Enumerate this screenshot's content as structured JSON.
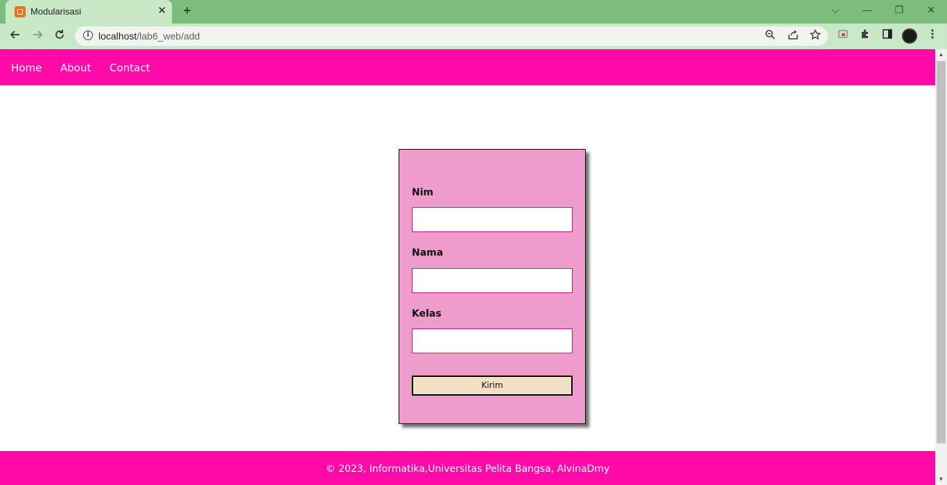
{
  "browser": {
    "tab_title": "Modularisasi",
    "tab_close": "✕",
    "new_tab": "+",
    "url_host": "localhost",
    "url_path": "/lab6_web/add",
    "window_controls": {
      "dropdown": "⌵",
      "minimize": "—",
      "restore": "❐",
      "close": "✕"
    },
    "icons": [
      "back-icon",
      "forward-icon",
      "reload-icon",
      "site-info-icon",
      "zoom-icon",
      "share-icon",
      "bookmark-star-icon",
      "cast-icon",
      "extensions-icon",
      "side-panel-icon",
      "profile-avatar",
      "menu-kebab-icon"
    ],
    "accent_color": "#7dbd7b"
  },
  "nav": {
    "items": [
      {
        "label": "Home"
      },
      {
        "label": "About"
      },
      {
        "label": "Contact"
      }
    ],
    "color": "#ff0aa9"
  },
  "form": {
    "fields": [
      {
        "label": "Nim",
        "value": ""
      },
      {
        "label": "Nama",
        "value": ""
      },
      {
        "label": "Kelas",
        "value": ""
      }
    ],
    "submit_label": "Kirim",
    "card_color": "#ee9ccb"
  },
  "footer": {
    "text": "© 2023, Informatika,Universitas Pelita Bangsa, AlvinaDmy"
  }
}
